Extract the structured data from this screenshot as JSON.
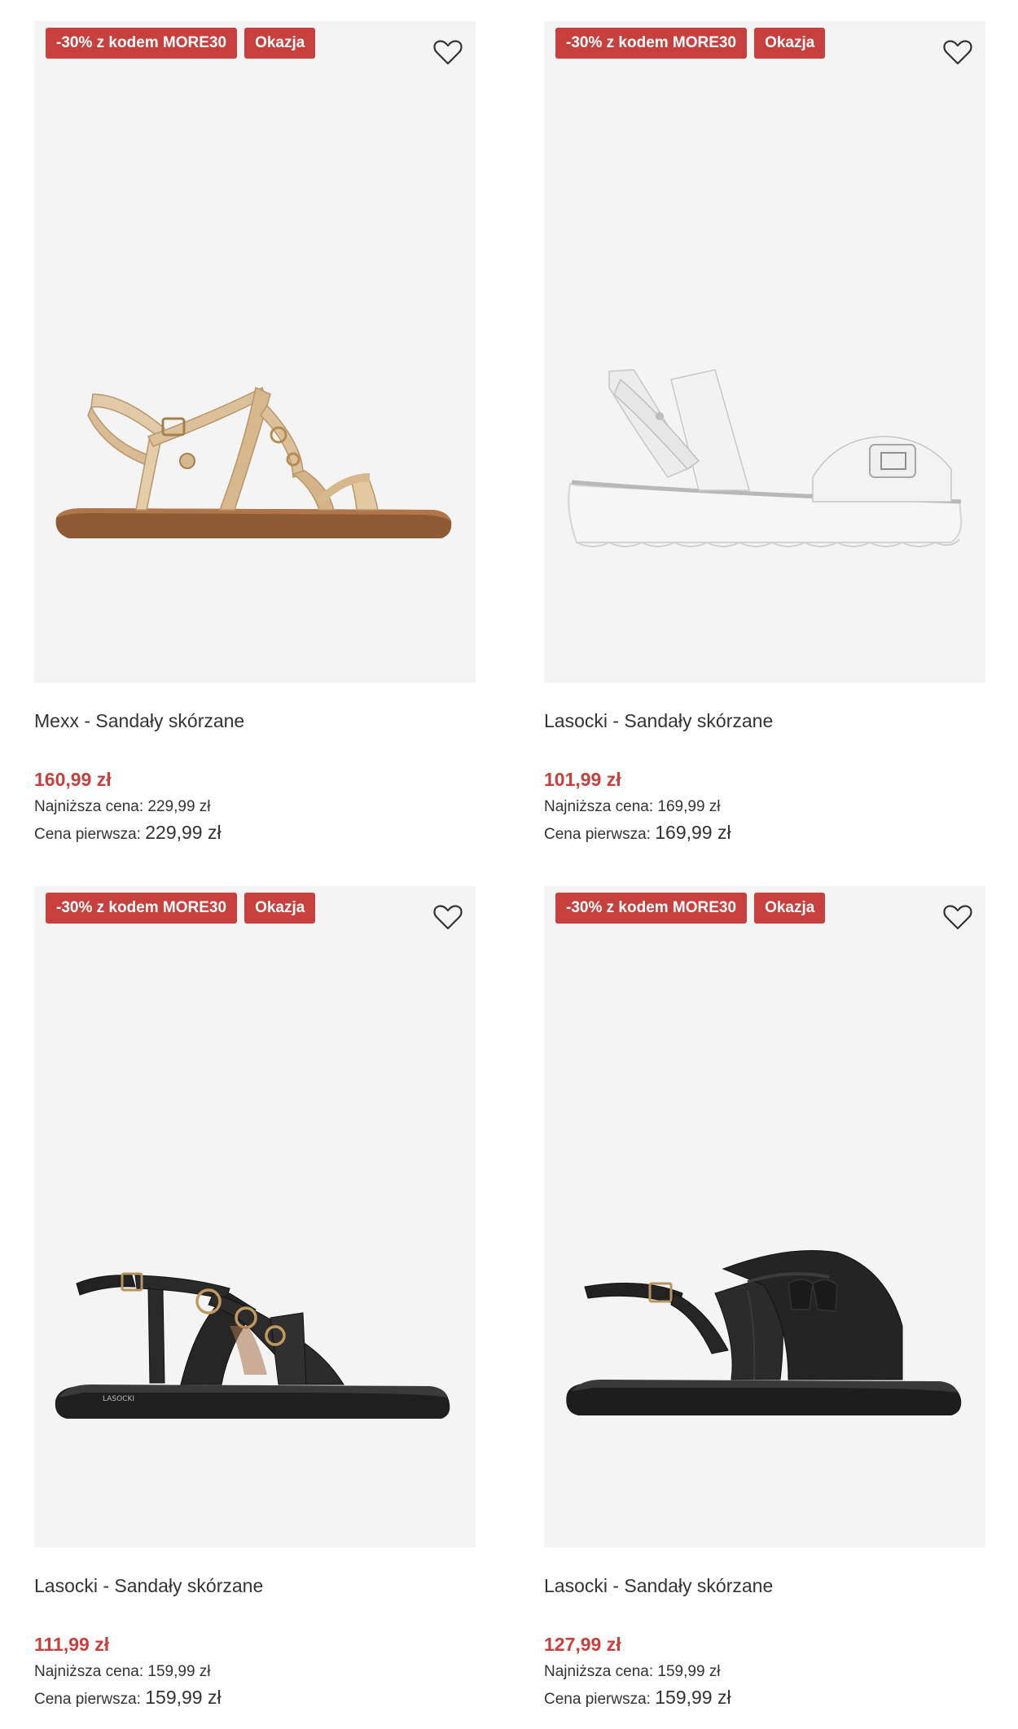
{
  "colors": {
    "accent": "#c7403d",
    "image_bg": "#f4f4f4"
  },
  "products": [
    {
      "discount_badge": "-30% z kodem MORE30",
      "deal_badge": "Okazja",
      "name": "Mexx - Sandały skórzane",
      "price": "160,99 zł",
      "lowest_label": "Najniższa cena:",
      "lowest_value": "229,99 zł",
      "original_label": "Cena pierwsza:",
      "original_value": "229,99 zł",
      "image": "gold-strappy-sandal",
      "icon": "heart-icon"
    },
    {
      "discount_badge": "-30% z kodem MORE30",
      "deal_badge": "Okazja",
      "name": "Lasocki - Sandały skórzane",
      "price": "101,99 zł",
      "lowest_label": "Najniższa cena:",
      "lowest_value": "169,99 zł",
      "original_label": "Cena pierwsza:",
      "original_value": "169,99 zł",
      "image": "white-platform-sandal",
      "icon": "heart-icon"
    },
    {
      "discount_badge": "-30% z kodem MORE30",
      "deal_badge": "Okazja",
      "name": "Lasocki - Sandały skórzane",
      "price": "111,99 zł",
      "lowest_label": "Najniższa cena:",
      "lowest_value": "159,99 zł",
      "original_label": "Cena pierwsza:",
      "original_value": "159,99 zł",
      "image": "black-crossstrap-sandal",
      "icon": "heart-icon"
    },
    {
      "discount_badge": "-30% z kodem MORE30",
      "deal_badge": "Okazja",
      "name": "Lasocki - Sandały skórzane",
      "price": "127,99 zł",
      "lowest_label": "Najniższa cena:",
      "lowest_value": "159,99 zł",
      "original_label": "Cena pierwsza:",
      "original_value": "159,99 zł",
      "image": "black-tassel-sandal",
      "icon": "heart-icon"
    }
  ]
}
